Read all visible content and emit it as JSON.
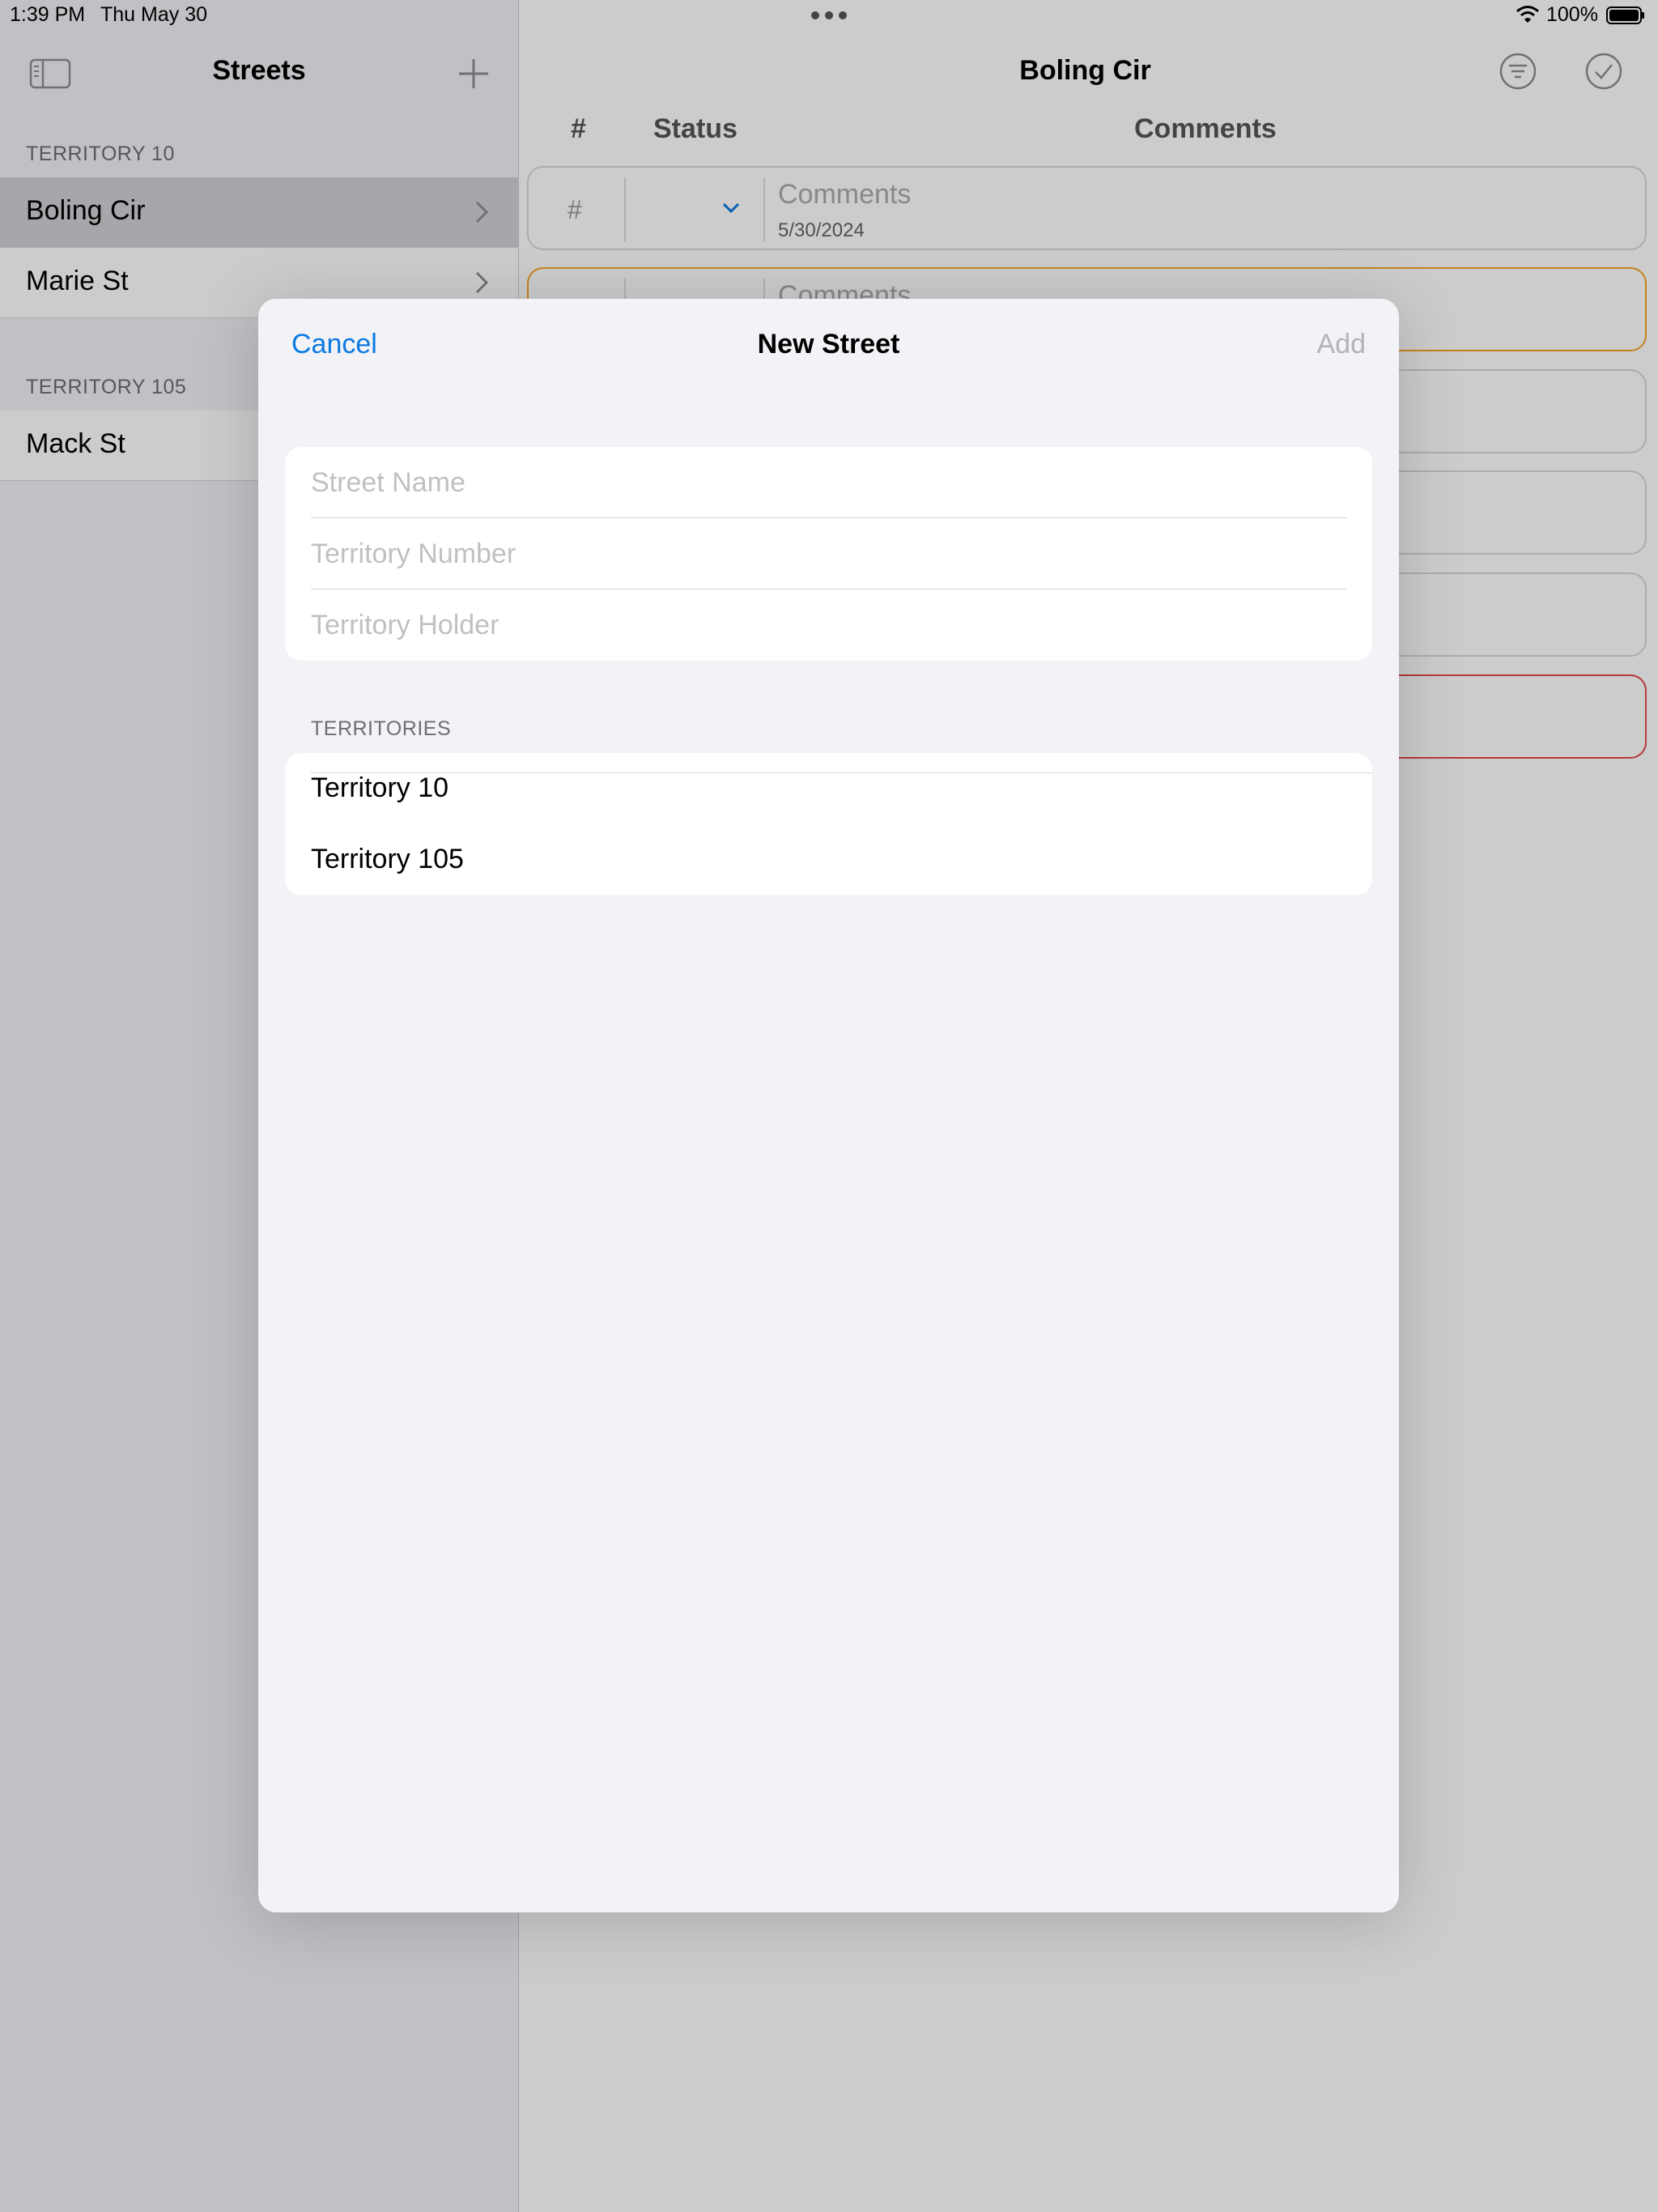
{
  "status_bar": {
    "time": "1:39 PM",
    "date": "Thu May 30",
    "battery": "100%"
  },
  "sidebar": {
    "title": "Streets",
    "sections": [
      {
        "header": "TERRITORY 10",
        "items": [
          {
            "label": "Boling Cir",
            "selected": true
          },
          {
            "label": "Marie St",
            "selected": false
          }
        ]
      },
      {
        "header": "TERRITORY 105",
        "items": [
          {
            "label": "Mack St",
            "selected": false
          }
        ]
      }
    ]
  },
  "detail": {
    "title": "Boling Cir",
    "columns": {
      "number": "#",
      "status": "Status",
      "comments": "Comments"
    },
    "first_card": {
      "number_placeholder": "#",
      "comments_placeholder": "Comments",
      "date": "5/30/2024"
    },
    "second_card": {
      "comments_placeholder": "Comments"
    }
  },
  "modal": {
    "cancel_label": "Cancel",
    "title": "New Street",
    "add_label": "Add",
    "fields": {
      "street_name_placeholder": "Street Name",
      "territory_number_placeholder": "Territory Number",
      "territory_holder_placeholder": "Territory Holder"
    },
    "territories_header": "TERRITORIES",
    "territories": [
      "Territory 10",
      "Territory 105"
    ]
  },
  "colors": {
    "accent": "#0a7ae2",
    "disabled": "#b4b4b8",
    "orange_border": "#f5a623",
    "red_border": "#e5484d"
  }
}
